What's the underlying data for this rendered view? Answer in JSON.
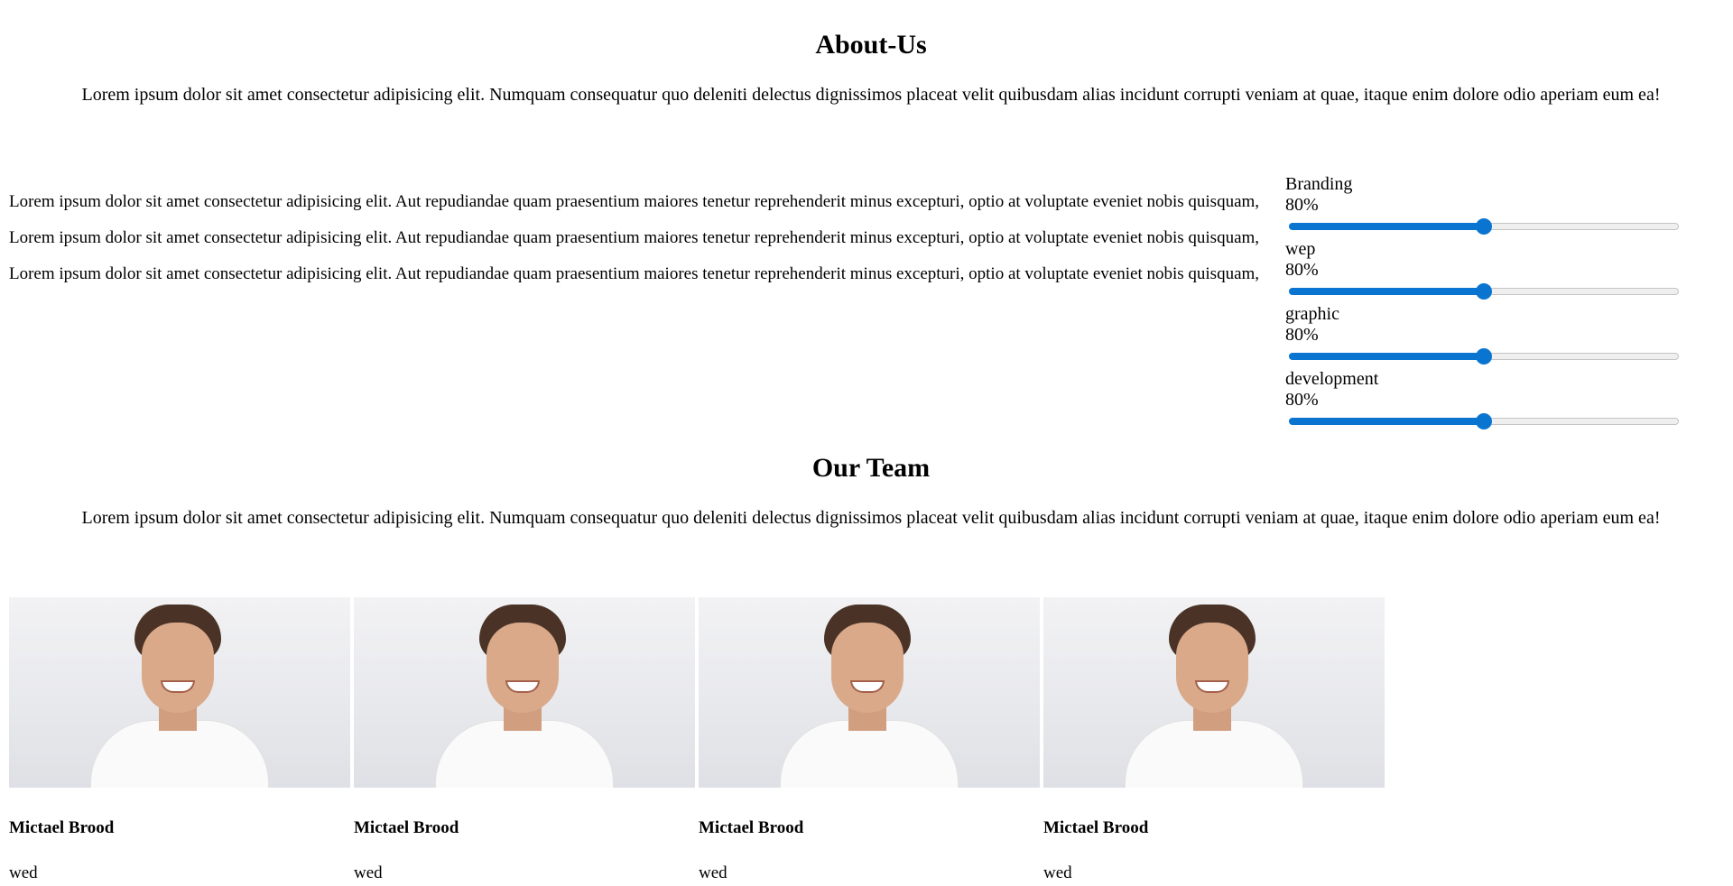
{
  "about": {
    "title": "About-Us",
    "lead": "Lorem ipsum dolor sit amet consectetur adipisicing elit. Numquam consequatur quo deleniti delectus dignissimos placeat velit quibusdam alias incidunt corrupti veniam at quae, itaque enim dolore odio aperiam eum ea!",
    "paragraphs": [
      "Lorem ipsum dolor sit amet consectetur adipisicing elit. Aut repudiandae quam praesentium maiores tenetur reprehenderit minus excepturi, optio at voluptate eveniet nobis quisquam,",
      "Lorem ipsum dolor sit amet consectetur adipisicing elit. Aut repudiandae quam praesentium maiores tenetur reprehenderit minus excepturi, optio at voluptate eveniet nobis quisquam,",
      "Lorem ipsum dolor sit amet consectetur adipisicing elit. Aut repudiandae quam praesentium maiores tenetur reprehenderit minus excepturi, optio at voluptate eveniet nobis quisquam,"
    ]
  },
  "skills": [
    {
      "label": "Branding",
      "value_text": "80%",
      "slider_value": 0.5
    },
    {
      "label": "wep",
      "value_text": "80%",
      "slider_value": 0.5
    },
    {
      "label": "graphic",
      "value_text": "80%",
      "slider_value": 0.5
    },
    {
      "label": "development",
      "value_text": "80%",
      "slider_value": 0.5
    }
  ],
  "team": {
    "title": "Our Team",
    "lead": "Lorem ipsum dolor sit amet consectetur adipisicing elit. Numquam consequatur quo deleniti delectus dignissimos placeat velit quibusdam alias incidunt corrupti veniam at quae, itaque enim dolore odio aperiam eum ea!",
    "members": [
      {
        "name": "Mictael Brood",
        "role": "wed"
      },
      {
        "name": "Mictael Brood",
        "role": "wed"
      },
      {
        "name": "Mictael Brood",
        "role": "wed"
      },
      {
        "name": "Mictael Brood",
        "role": "wed"
      }
    ]
  },
  "colors": {
    "slider_accent": "#0a75d1",
    "slider_track": "#efefef"
  }
}
